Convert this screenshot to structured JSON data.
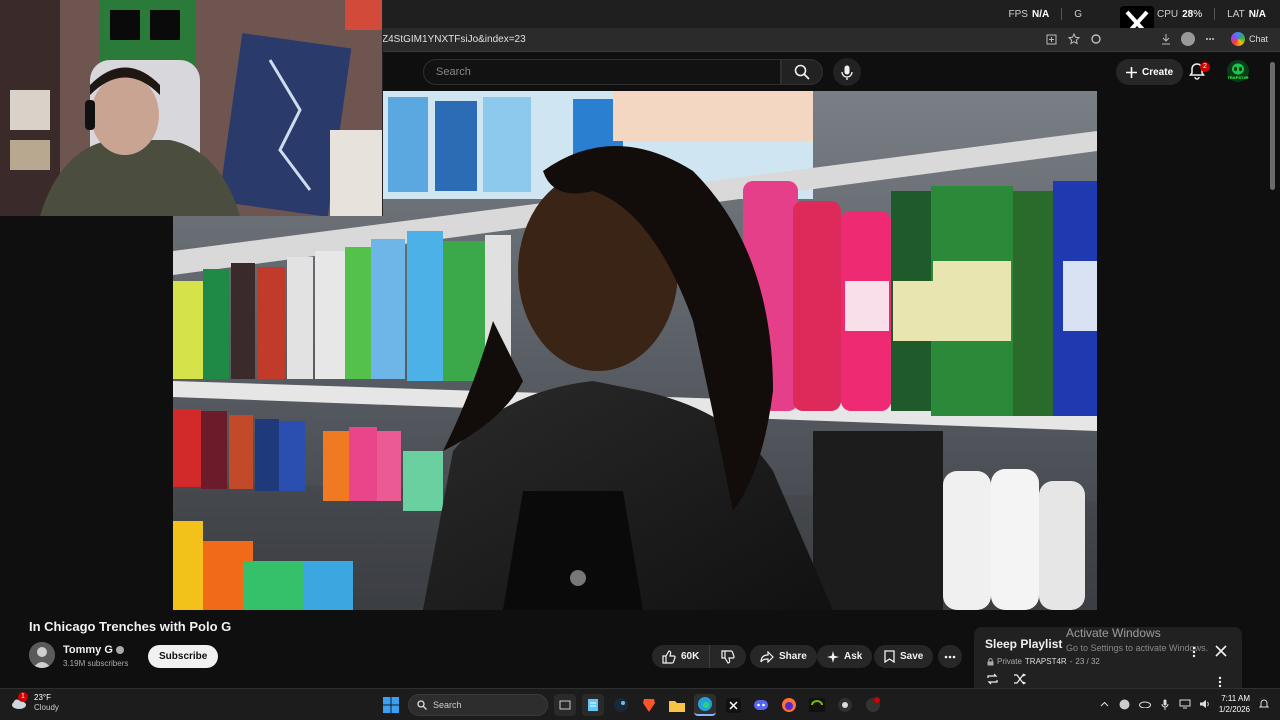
{
  "hud": {
    "fps_label": "FPS",
    "fps_value": "N/A",
    "gpu_label": "G",
    "cpu_label": "CPU",
    "cpu_value": "28",
    "cpu_unit": "%",
    "lat_label": "LAT",
    "lat_value": "N/A"
  },
  "browser": {
    "url": "Z4StGIM1YNXTFsiJo&index=23",
    "chat_label": "Chat"
  },
  "yt": {
    "search_placeholder": "Search",
    "create_label": "Create",
    "notification_count": "2",
    "avatar_text": "TRAPST4R"
  },
  "video": {
    "title": "In Chicago Trenches with Polo G",
    "channel": "Tommy G",
    "subscribers": "3.19M subscribers",
    "subscribe_label": "Subscribe",
    "likes": "60K",
    "share_label": "Share",
    "ask_label": "Ask",
    "save_label": "Save"
  },
  "playlist": {
    "title": "Sleep Playlist",
    "privacy": "Private",
    "owner": "TRAPST4R",
    "position": "23 / 32"
  },
  "windows_watermark": {
    "title": "Activate Windows",
    "subtitle": "Go to Settings to activate Windows."
  },
  "taskbar": {
    "weather_badge": "1",
    "temperature": "23°F",
    "condition": "Cloudy",
    "search_label": "Search",
    "time": "7:11 AM",
    "date": "1/2/2026"
  },
  "colors": {
    "accent_red": "#cc0000",
    "yt_bg": "#0f0f0f",
    "pill_bg": "#272727"
  }
}
